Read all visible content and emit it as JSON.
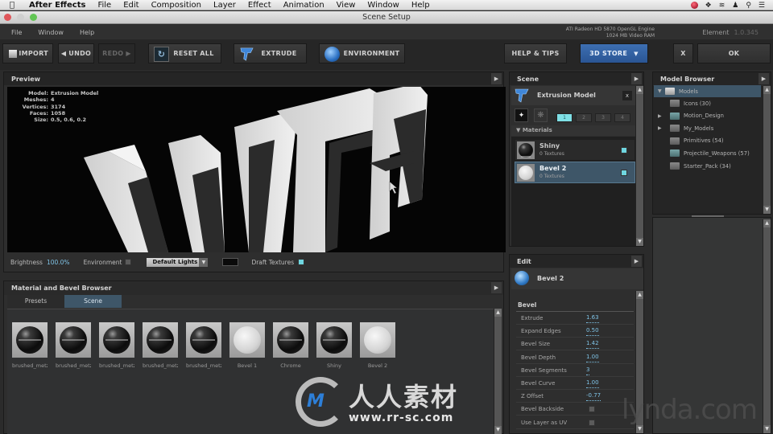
{
  "mac_menubar": {
    "app": "After Effects",
    "items": [
      "File",
      "Edit",
      "Composition",
      "Layer",
      "Effect",
      "Animation",
      "View",
      "Window",
      "Help"
    ]
  },
  "window": {
    "title": "Scene Setup"
  },
  "app_menu": {
    "items": [
      "File",
      "Window",
      "Help"
    ],
    "gpu_line1": "ATI Radeon HD 5870 OpenGL Engine",
    "gpu_line2": "1024 MB Video RAM",
    "product": "Element",
    "version": "1.0.345"
  },
  "toolbar": {
    "import": "IMPORT",
    "undo": "UNDO",
    "redo": "REDO",
    "reset_all": "RESET ALL",
    "extrude": "EXTRUDE",
    "environment": "ENVIRONMENT",
    "help_tips": "HELP & TIPS",
    "store": "3D STORE",
    "close": "X",
    "ok": "OK"
  },
  "preview": {
    "title": "Preview",
    "stats": [
      {
        "k": "Model:",
        "v": "Extrusion Model"
      },
      {
        "k": "Meshes:",
        "v": "4"
      },
      {
        "k": "Vertices:",
        "v": "3174"
      },
      {
        "k": "Faces:",
        "v": "1058"
      },
      {
        "k": "Size:",
        "v": "0.5, 0.6, 0.2"
      }
    ],
    "scene_text": "WITH",
    "brightness_label": "Brightness",
    "brightness_value": "100.0%",
    "environment_label": "Environment",
    "lights_value": "Default Lights",
    "draft_textures_label": "Draft Textures"
  },
  "material_browser": {
    "title": "Material and Bevel Browser",
    "tabs": [
      "Presets",
      "Scene"
    ],
    "active_tab": "Scene",
    "swatches": [
      {
        "label": "brushed_metz",
        "style": "dark"
      },
      {
        "label": "brushed_metz",
        "style": "dark"
      },
      {
        "label": "brushed_metz",
        "style": "dark"
      },
      {
        "label": "brushed_metz",
        "style": "dark"
      },
      {
        "label": "brushed_metz",
        "style": "dark"
      },
      {
        "label": "Bevel 1",
        "style": "light"
      },
      {
        "label": "Chrome",
        "style": "dark"
      },
      {
        "label": "Shiny",
        "style": "dark"
      },
      {
        "label": "Bevel 2",
        "style": "light"
      }
    ]
  },
  "scene_panel": {
    "title": "Scene",
    "model_name": "Extrusion Model",
    "close": "x",
    "groups": [
      "1",
      "2",
      "3",
      "4"
    ],
    "active_group": "1",
    "materials_header": "Materials",
    "materials": [
      {
        "name": "Shiny",
        "sub": "0 Textures",
        "selected": false
      },
      {
        "name": "Bevel 2",
        "sub": "0 Textures",
        "selected": true
      }
    ]
  },
  "edit_panel": {
    "title": "Edit",
    "material": "Bevel 2",
    "section": "Bevel",
    "params": [
      {
        "k": "Extrude",
        "v": "1.63"
      },
      {
        "k": "Expand Edges",
        "v": "0.50"
      },
      {
        "k": "Bevel Size",
        "v": "1.42"
      },
      {
        "k": "Bevel Depth",
        "v": "1.00"
      },
      {
        "k": "Bevel Segments",
        "v": "3"
      },
      {
        "k": "Bevel Curve",
        "v": "1.00"
      },
      {
        "k": "Z Offset",
        "v": "-0.77"
      }
    ],
    "checks": [
      {
        "k": "Bevel Backside",
        "checked": false
      },
      {
        "k": "Use Layer as UV",
        "checked": false
      }
    ]
  },
  "model_browser": {
    "title": "Model Browser",
    "root": "Models",
    "items": [
      {
        "label": "Icons (30)",
        "expandable": false,
        "teal": false
      },
      {
        "label": "Motion_Design",
        "expandable": true,
        "teal": true
      },
      {
        "label": "My_Models",
        "expandable": true,
        "teal": false
      },
      {
        "label": "Primitives (54)",
        "expandable": false,
        "teal": false
      },
      {
        "label": "Projectile_Weapons (57)",
        "expandable": false,
        "teal": true
      },
      {
        "label": "Starter_Pack (34)",
        "expandable": false,
        "teal": false
      }
    ]
  },
  "watermarks": {
    "rrsc_cn": "人人素材",
    "rrsc_url": "www.rr-sc.com",
    "lynda": "lynda.com"
  },
  "colors": {
    "accent_blue": "#2a5594",
    "selection": "#3e5668",
    "cyan_check": "#6fd6e0",
    "value_blue": "#7fc3e6"
  }
}
